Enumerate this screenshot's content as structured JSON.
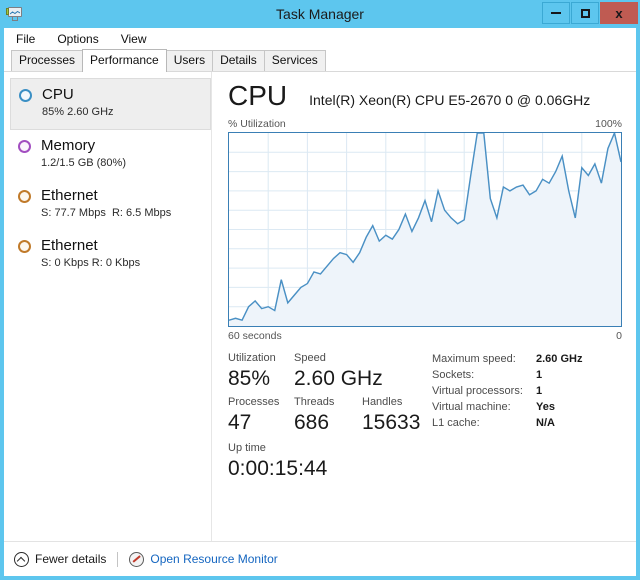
{
  "window": {
    "title": "Task Manager",
    "icon": "task-manager-monitor-icon",
    "accent_color": "#5dc6ee",
    "buttons": {
      "minimize": "–",
      "maximize": "□",
      "close": "x"
    }
  },
  "menubar": {
    "items": [
      "File",
      "Options",
      "View"
    ]
  },
  "tabs": [
    {
      "label": "Processes",
      "active": false
    },
    {
      "label": "Performance",
      "active": true
    },
    {
      "label": "Users",
      "active": false
    },
    {
      "label": "Details",
      "active": false
    },
    {
      "label": "Services",
      "active": false
    }
  ],
  "sidebar": {
    "items": [
      {
        "title": "CPU",
        "sub": "85%  2.60 GHz",
        "color": "#3a8fc4",
        "selected": true
      },
      {
        "title": "Memory",
        "sub": "1.2/1.5 GB (80%)",
        "color": "#a24ec0",
        "selected": false
      },
      {
        "title": "Ethernet",
        "sub_s": "S: 77.7 Mbps",
        "sub_r": "R: 6.5 Mbps",
        "color": "#c07a2a",
        "selected": false
      },
      {
        "title": "Ethernet",
        "sub_s": "S: 0 Kbps",
        "sub_r": "R: 0 Kbps",
        "color": "#c07a2a",
        "selected": false
      }
    ]
  },
  "detail": {
    "title": "CPU",
    "subtitle": "Intel(R) Xeon(R) CPU E5-2670 0 @ 0.06GHz",
    "graph_top_left_label": "% Utilization",
    "graph_top_right_label": "100%",
    "graph_bottom_left_label": "60 seconds",
    "graph_bottom_right_label": "0",
    "stats": {
      "utilization_label": "Utilization",
      "utilization_value": "85%",
      "speed_label": "Speed",
      "speed_value": "2.60 GHz",
      "processes_label": "Processes",
      "processes_value": "47",
      "threads_label": "Threads",
      "threads_value": "686",
      "handles_label": "Handles",
      "handles_value": "15633",
      "uptime_label": "Up time",
      "uptime_value": "0:00:15:44"
    },
    "info": [
      {
        "label": "Maximum speed:",
        "value": "2.60 GHz"
      },
      {
        "label": "Sockets:",
        "value": "1"
      },
      {
        "label": "Virtual processors:",
        "value": "1"
      },
      {
        "label": "Virtual machine:",
        "value": "Yes"
      },
      {
        "label": "L1 cache:",
        "value": "N/A"
      }
    ]
  },
  "statusbar": {
    "fewer_details": "Fewer details",
    "fewer_details_icon": "chevron-up-circle-icon",
    "open_resource_monitor": "Open Resource Monitor",
    "resource_monitor_icon": "resource-monitor-icon"
  },
  "chart_data": {
    "type": "area",
    "title": "CPU % Utilization",
    "xlabel": "60 seconds",
    "ylabel": "% Utilization",
    "xlim": [
      60,
      0
    ],
    "ylim": [
      0,
      100
    ],
    "grid": true,
    "line_color": "#4a90c4",
    "fill_color": "#eef4fa",
    "series": [
      {
        "name": "CPU Utilization",
        "values": [
          3,
          4,
          3,
          10,
          13,
          9,
          10,
          8,
          24,
          12,
          16,
          20,
          22,
          28,
          27,
          31,
          35,
          38,
          37,
          33,
          38,
          46,
          52,
          44,
          47,
          45,
          50,
          58,
          49,
          56,
          65,
          54,
          70,
          60,
          56,
          53,
          55,
          78,
          100,
          100,
          66,
          56,
          72,
          70,
          72,
          73,
          68,
          70,
          76,
          74,
          80,
          88,
          70,
          56,
          82,
          78,
          84,
          74,
          92,
          100,
          85
        ]
      }
    ]
  }
}
